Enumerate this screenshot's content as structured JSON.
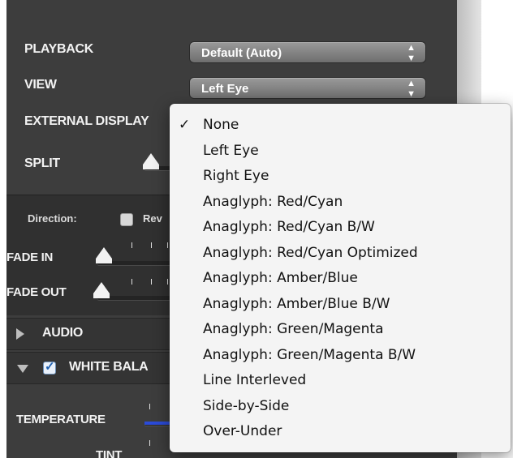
{
  "playback": {
    "label": "PLAYBACK",
    "value": "Default (Auto)"
  },
  "view": {
    "label": "VIEW",
    "value": "Left Eye"
  },
  "external_display": {
    "label": "EXTERNAL DISPLAY"
  },
  "split": {
    "label": "SPLIT"
  },
  "direction": {
    "label": "Direction:",
    "checkbox_label": "Rev"
  },
  "fade_in": {
    "label": "FADE IN"
  },
  "fade_out": {
    "label": "FADE OUT"
  },
  "audio": {
    "label": "AUDIO"
  },
  "white_balance": {
    "label": "WHITE BALA",
    "checked": true
  },
  "temperature": {
    "label": "TEMPERATURE"
  },
  "tint": {
    "label": "TINT"
  },
  "arrows_glyph": "⬍",
  "check_glyph": "✓",
  "menu": {
    "selected_index": 0,
    "items": [
      "None",
      "Left Eye",
      "Right Eye",
      "Anaglyph: Red/Cyan",
      "Anaglyph: Red/Cyan B/W",
      "Anaglyph: Red/Cyan Optimized",
      "Anaglyph: Amber/Blue",
      "Anaglyph: Amber/Blue B/W",
      "Anaglyph: Green/Magenta",
      "Anaglyph: Green/Magenta B/W",
      "Line Interleved",
      "Side-by-Side",
      "Over-Under"
    ]
  },
  "colors": {
    "panel_bg": "#3d3d3d",
    "menu_bg": "#f4f4f4",
    "temperature_accent": "#2b4bd8"
  }
}
